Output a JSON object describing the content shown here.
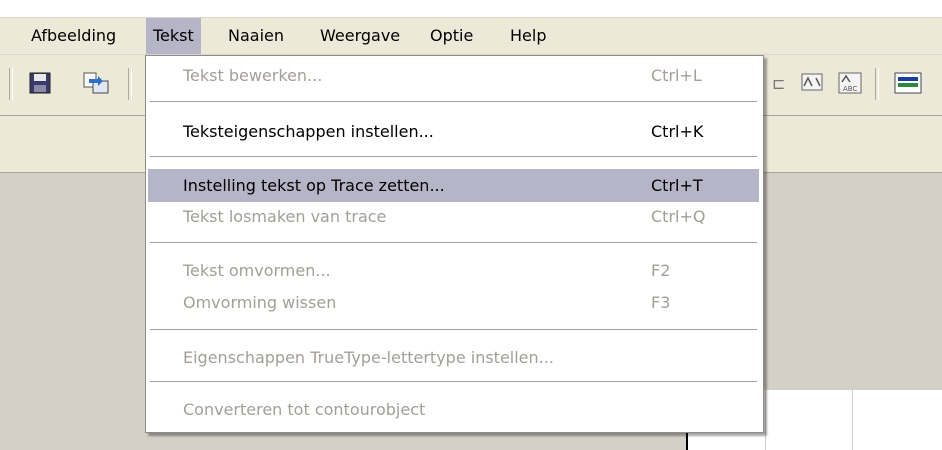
{
  "menubar": {
    "items": [
      {
        "label": "Afbeelding"
      },
      {
        "label": "Tekst"
      },
      {
        "label": "Naaien"
      },
      {
        "label": "Weergave"
      },
      {
        "label": "Optie"
      },
      {
        "label": "Help"
      }
    ]
  },
  "toolbar": {
    "left_icons": [
      "save-icon",
      "import-icon"
    ],
    "right_icons": [
      "text-tool-icon",
      "word-art-icon",
      "abc-text-icon",
      "color-bar-icon"
    ]
  },
  "tekst_menu": {
    "items": [
      {
        "label": "Tekst bewerken...",
        "shortcut": "Ctrl+L",
        "enabled": false
      },
      {
        "label": "Teksteigenschappen instellen...",
        "shortcut": "Ctrl+K",
        "enabled": true
      },
      {
        "label": "Instelling tekst op Trace zetten...",
        "shortcut": "Ctrl+T",
        "enabled": true,
        "highlighted": true
      },
      {
        "label": "Tekst losmaken van trace",
        "shortcut": "Ctrl+Q",
        "enabled": false
      },
      {
        "label": "Tekst omvormen...",
        "shortcut": "F2",
        "enabled": false
      },
      {
        "label": "Omvorming wissen",
        "shortcut": "F3",
        "enabled": false
      },
      {
        "label": "Eigenschappen TrueType-lettertype instellen...",
        "shortcut": "",
        "enabled": false
      },
      {
        "label": "Converteren tot contourobject",
        "shortcut": "",
        "enabled": false
      }
    ]
  },
  "colors": {
    "menu_highlight": "#b6b5c7",
    "disabled_text": "#a29f96",
    "chrome": "#ece9d8"
  }
}
